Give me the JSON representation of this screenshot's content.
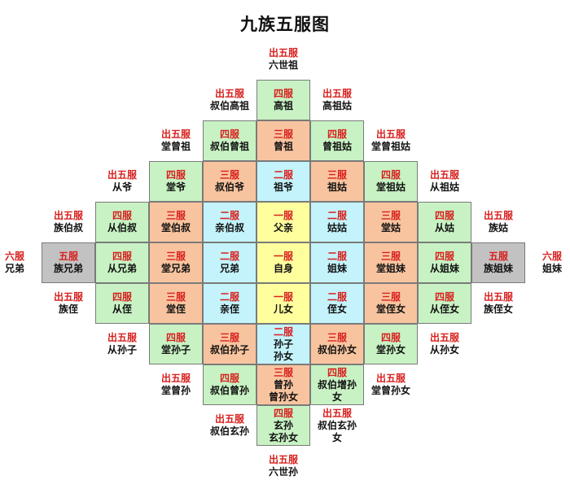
{
  "title": "九族五服图",
  "colors": {
    "一服": "#ffff9e",
    "二服": "#c4f3fb",
    "三服": "#f8c49f",
    "四服": "#c8f2c4",
    "五服": "#c2c2c2",
    "grade_text": "#d8201e"
  },
  "rows": [
    {
      "cells": [
        {
          "col": 0,
          "grade": "出五服",
          "names": [
            "六世祖"
          ],
          "fill": "none"
        }
      ]
    },
    {
      "cells": [
        {
          "col": -1,
          "grade": "出五服",
          "names": [
            "叔伯高祖"
          ],
          "fill": "none"
        },
        {
          "col": 0,
          "grade": "四服",
          "names": [
            "高祖"
          ],
          "fill": "四服"
        },
        {
          "col": 1,
          "grade": "出五服",
          "names": [
            "高祖姑"
          ],
          "fill": "none"
        }
      ]
    },
    {
      "cells": [
        {
          "col": -2,
          "grade": "出五服",
          "names": [
            "堂曾祖"
          ],
          "fill": "none"
        },
        {
          "col": -1,
          "grade": "四服",
          "names": [
            "叔伯曾祖"
          ],
          "fill": "四服"
        },
        {
          "col": 0,
          "grade": "三服",
          "names": [
            "曾祖"
          ],
          "fill": "三服"
        },
        {
          "col": 1,
          "grade": "四服",
          "names": [
            "曾祖姑"
          ],
          "fill": "四服"
        },
        {
          "col": 2,
          "grade": "出五服",
          "names": [
            "堂曾祖姑"
          ],
          "fill": "none"
        }
      ]
    },
    {
      "cells": [
        {
          "col": -3,
          "grade": "出五服",
          "names": [
            "从爷"
          ],
          "fill": "none"
        },
        {
          "col": -2,
          "grade": "四服",
          "names": [
            "堂爷"
          ],
          "fill": "四服"
        },
        {
          "col": -1,
          "grade": "三服",
          "names": [
            "叔伯爷"
          ],
          "fill": "三服"
        },
        {
          "col": 0,
          "grade": "二服",
          "names": [
            "祖爷"
          ],
          "fill": "二服"
        },
        {
          "col": 1,
          "grade": "三服",
          "names": [
            "祖姑"
          ],
          "fill": "三服"
        },
        {
          "col": 2,
          "grade": "四服",
          "names": [
            "堂祖姑"
          ],
          "fill": "四服"
        },
        {
          "col": 3,
          "grade": "出五服",
          "names": [
            "从祖姑"
          ],
          "fill": "none"
        }
      ]
    },
    {
      "cells": [
        {
          "col": -4,
          "grade": "出五服",
          "names": [
            "族伯叔"
          ],
          "fill": "none"
        },
        {
          "col": -3,
          "grade": "四服",
          "names": [
            "从伯叔"
          ],
          "fill": "四服"
        },
        {
          "col": -2,
          "grade": "三服",
          "names": [
            "堂伯叔"
          ],
          "fill": "三服"
        },
        {
          "col": -1,
          "grade": "二服",
          "names": [
            "亲伯叔"
          ],
          "fill": "二服"
        },
        {
          "col": 0,
          "grade": "一服",
          "names": [
            "父亲"
          ],
          "fill": "一服"
        },
        {
          "col": 1,
          "grade": "二服",
          "names": [
            "姑姑"
          ],
          "fill": "二服"
        },
        {
          "col": 2,
          "grade": "三服",
          "names": [
            "堂姑"
          ],
          "fill": "三服"
        },
        {
          "col": 3,
          "grade": "四服",
          "names": [
            "从姑"
          ],
          "fill": "四服"
        },
        {
          "col": 4,
          "grade": "出五服",
          "names": [
            "族姑"
          ],
          "fill": "none"
        }
      ]
    },
    {
      "cells": [
        {
          "col": -5,
          "grade": "六服",
          "names": [
            "兄弟"
          ],
          "fill": "none"
        },
        {
          "col": -4,
          "grade": "五服",
          "names": [
            "族兄弟"
          ],
          "fill": "五服"
        },
        {
          "col": -3,
          "grade": "四服",
          "names": [
            "从兄弟"
          ],
          "fill": "四服"
        },
        {
          "col": -2,
          "grade": "三服",
          "names": [
            "堂兄弟"
          ],
          "fill": "三服"
        },
        {
          "col": -1,
          "grade": "二服",
          "names": [
            "兄弟"
          ],
          "fill": "二服"
        },
        {
          "col": 0,
          "grade": "一服",
          "names": [
            "自身"
          ],
          "fill": "一服"
        },
        {
          "col": 1,
          "grade": "二服",
          "names": [
            "姐妹"
          ],
          "fill": "二服"
        },
        {
          "col": 2,
          "grade": "三服",
          "names": [
            "堂姐妹"
          ],
          "fill": "三服"
        },
        {
          "col": 3,
          "grade": "四服",
          "names": [
            "从姐妹"
          ],
          "fill": "四服"
        },
        {
          "col": 4,
          "grade": "五服",
          "names": [
            "族姐妹"
          ],
          "fill": "五服"
        },
        {
          "col": 5,
          "grade": "六服",
          "names": [
            "姐妹"
          ],
          "fill": "none"
        }
      ]
    },
    {
      "cells": [
        {
          "col": -4,
          "grade": "出五服",
          "names": [
            "族侄"
          ],
          "fill": "none"
        },
        {
          "col": -3,
          "grade": "四服",
          "names": [
            "从侄"
          ],
          "fill": "四服"
        },
        {
          "col": -2,
          "grade": "三服",
          "names": [
            "堂侄"
          ],
          "fill": "三服"
        },
        {
          "col": -1,
          "grade": "二服",
          "names": [
            "亲侄"
          ],
          "fill": "二服"
        },
        {
          "col": 0,
          "grade": "一服",
          "names": [
            "儿女"
          ],
          "fill": "一服"
        },
        {
          "col": 1,
          "grade": "二服",
          "names": [
            "侄女"
          ],
          "fill": "二服"
        },
        {
          "col": 2,
          "grade": "三服",
          "names": [
            "堂侄女"
          ],
          "fill": "三服"
        },
        {
          "col": 3,
          "grade": "四服",
          "names": [
            "从侄女"
          ],
          "fill": "四服"
        },
        {
          "col": 4,
          "grade": "出五服",
          "names": [
            "族侄女"
          ],
          "fill": "none"
        }
      ]
    },
    {
      "cells": [
        {
          "col": -3,
          "grade": "出五服",
          "names": [
            "从孙子"
          ],
          "fill": "none"
        },
        {
          "col": -2,
          "grade": "四服",
          "names": [
            "堂孙子"
          ],
          "fill": "四服"
        },
        {
          "col": -1,
          "grade": "三服",
          "names": [
            "叔伯孙子"
          ],
          "fill": "三服"
        },
        {
          "col": 0,
          "grade": "二服",
          "names": [
            "孙子",
            "孙女"
          ],
          "fill": "二服"
        },
        {
          "col": 1,
          "grade": "三服",
          "names": [
            "叔伯孙女"
          ],
          "fill": "三服"
        },
        {
          "col": 2,
          "grade": "四服",
          "names": [
            "堂孙女"
          ],
          "fill": "四服"
        },
        {
          "col": 3,
          "grade": "出五服",
          "names": [
            "从孙女"
          ],
          "fill": "none"
        }
      ]
    },
    {
      "cells": [
        {
          "col": -2,
          "grade": "出五服",
          "names": [
            "堂曾孙"
          ],
          "fill": "none"
        },
        {
          "col": -1,
          "grade": "四服",
          "names": [
            "叔伯曾孙"
          ],
          "fill": "四服"
        },
        {
          "col": 0,
          "grade": "三服",
          "names": [
            "曾孙",
            "曾孙女"
          ],
          "fill": "三服"
        },
        {
          "col": 1,
          "grade": "四服",
          "names": [
            "叔伯增孙",
            "女"
          ],
          "fill": "四服"
        },
        {
          "col": 2,
          "grade": "出五服",
          "names": [
            "堂曾孙女"
          ],
          "fill": "none"
        }
      ]
    },
    {
      "cells": [
        {
          "col": -1,
          "grade": "出五服",
          "names": [
            "叔伯玄孙"
          ],
          "fill": "none"
        },
        {
          "col": 0,
          "grade": "四服",
          "names": [
            "玄孙",
            "玄孙女"
          ],
          "fill": "四服"
        },
        {
          "col": 1,
          "grade": "出五服",
          "names": [
            "叔伯玄孙",
            "女"
          ],
          "fill": "none"
        }
      ]
    },
    {
      "cells": [
        {
          "col": 0,
          "grade": "出五服",
          "names": [
            "六世孙"
          ],
          "fill": "none"
        }
      ]
    }
  ]
}
